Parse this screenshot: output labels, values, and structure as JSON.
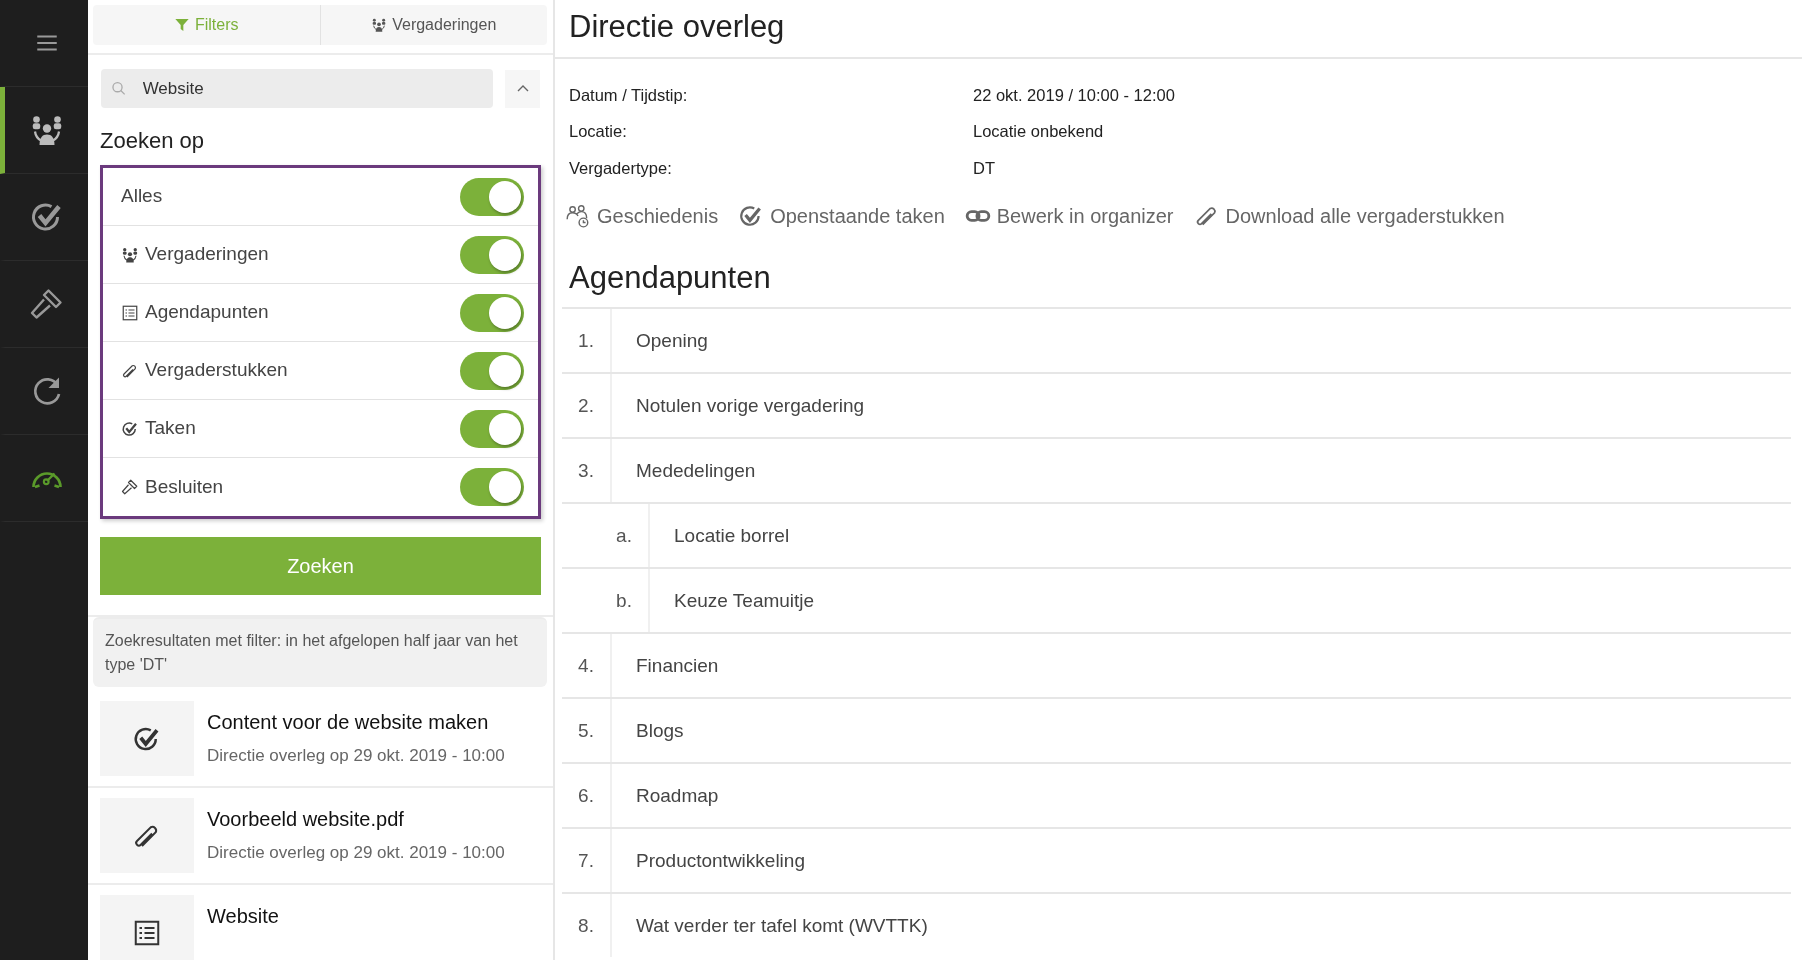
{
  "sidebar": {
    "items": [
      {
        "kind": "menu",
        "selected": false
      },
      {
        "kind": "meetings",
        "selected": true
      },
      {
        "kind": "tasks",
        "selected": false
      },
      {
        "kind": "decisions",
        "selected": false
      },
      {
        "kind": "history",
        "selected": false
      },
      {
        "kind": "dashboard",
        "selected": false
      }
    ]
  },
  "tabs": [
    {
      "kind": "filter",
      "label": "Filters",
      "selected": true
    },
    {
      "kind": "meetings",
      "label": "Vergaderingen",
      "selected": false
    }
  ],
  "search": {
    "value": "Website",
    "expanded": true
  },
  "filter_heading": "Zoeken op",
  "filters": [
    {
      "kind": "all",
      "label": "Alles",
      "on": true
    },
    {
      "kind": "meetings",
      "label": "Vergaderingen",
      "on": true
    },
    {
      "kind": "agenda",
      "label": "Agendapunten",
      "on": true
    },
    {
      "kind": "documents",
      "label": "Vergaderstukken",
      "on": true
    },
    {
      "kind": "tasks",
      "label": "Taken",
      "on": true
    },
    {
      "kind": "decisions",
      "label": "Besluiten",
      "on": true
    }
  ],
  "search_button": "Zoeken",
  "results_summary": "Zoekresultaten met filter: in het afgelopen half jaar van het type 'DT'",
  "results": [
    {
      "kind": "tasks",
      "title": "Content voor de website maken",
      "subtitle": "Directie overleg op 29 okt. 2019 - 10:00"
    },
    {
      "kind": "documents",
      "title": "Voorbeeld website.pdf",
      "subtitle": "Directie overleg op 29 okt. 2019 - 10:00"
    },
    {
      "kind": "agenda",
      "title": "Website"
    }
  ],
  "meeting": {
    "title": "Directie overleg",
    "details": [
      {
        "label": "Datum / Tijdstip:",
        "value": "22 okt. 2019 / 10:00 - 12:00"
      },
      {
        "label": "Locatie:",
        "value": "Locatie onbekend"
      },
      {
        "label": "Vergadertype:",
        "value": "DT"
      }
    ],
    "actions": [
      {
        "kind": "people_history",
        "label": "Geschiedenis"
      },
      {
        "kind": "tasks",
        "label": "Openstaande taken"
      },
      {
        "kind": "link",
        "label": "Bewerk in organizer"
      },
      {
        "kind": "documents",
        "label": "Download alle vergaderstukken"
      }
    ]
  },
  "agenda": {
    "title": "Agendapunten",
    "items": [
      {
        "number": "1.",
        "title": "Opening"
      },
      {
        "number": "2.",
        "title": "Notulen vorige vergadering"
      },
      {
        "number": "3.",
        "title": "Mededelingen",
        "children": [
          {
            "number": "a.",
            "title": "Locatie borrel"
          },
          {
            "number": "b.",
            "title": "Keuze Teamuitje"
          }
        ]
      },
      {
        "number": "4.",
        "title": "Financien"
      },
      {
        "number": "5.",
        "title": "Blogs"
      },
      {
        "number": "6.",
        "title": "Roadmap"
      },
      {
        "number": "7.",
        "title": "Productontwikkeling"
      },
      {
        "number": "8.",
        "title": "Wat verder ter tafel komt (WVTTK)"
      }
    ]
  }
}
